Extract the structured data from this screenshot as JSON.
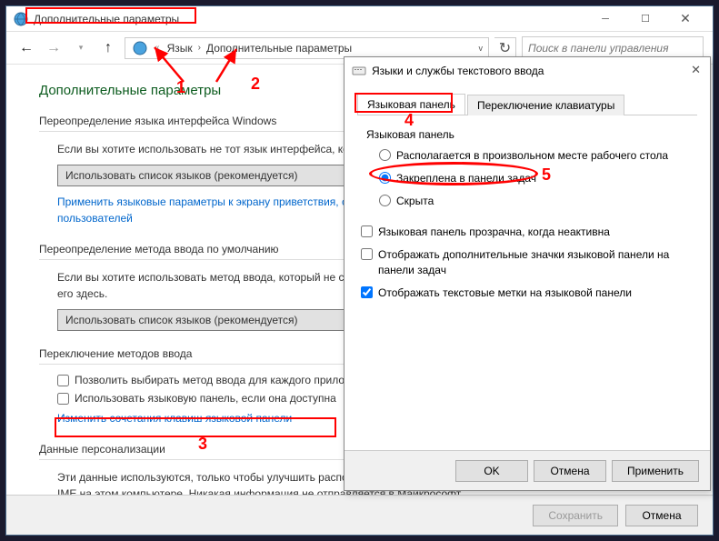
{
  "window": {
    "title": "Дополнительные параметры",
    "breadcrumb": {
      "prefix": "«",
      "item1": "Язык",
      "item2": "Дополнительные параметры"
    },
    "search_placeholder": "Поиск в панели управления"
  },
  "main": {
    "heading": "Дополнительные параметры",
    "section1": {
      "title": "Переопределение языка интерфейса Windows",
      "text": "Если вы хотите использовать не тот язык интерфейса, который соответствует вашему списку языков, выберите его здесь.",
      "combo": "Использовать список языков (рекомендуется)",
      "link": "Применить языковые параметры к экрану приветствия, системным учетным записям и новым учетным записям пользователей"
    },
    "section2": {
      "title": "Переопределение метода ввода по умолчанию",
      "text": "Если вы хотите использовать метод ввода, который не соответствует первому методу в вашем списке языков, выберите его здесь.",
      "combo": "Использовать список языков (рекомендуется)"
    },
    "section3": {
      "title": "Переключение методов ввода",
      "chk1": "Позволить выбирать метод ввода для каждого приложения",
      "chk2": "Использовать языковую панель, если она доступна",
      "link": "Изменить сочетания клавиш языковой панели"
    },
    "section4": {
      "title": "Данные персонализации",
      "text": "Эти данные используются, только чтобы улучшить распознавание рукописного ввода и текстовый ввод для языков без IME на этом компьютере. Никакая информация не отправляется в Майкрософт."
    },
    "buttons": {
      "save": "Сохранить",
      "cancel": "Отмена"
    }
  },
  "dialog": {
    "title": "Языки и службы текстового ввода",
    "tabs": {
      "tab1": "Языковая панель",
      "tab2": "Переключение клавиатуры"
    },
    "group1": {
      "title": "Языковая панель",
      "opt1": "Располагается в произвольном месте рабочего стола",
      "opt2": "Закреплена в панели задач",
      "opt3": "Скрыта"
    },
    "chk1": "Языковая панель прозрачна, когда неактивна",
    "chk2": "Отображать дополнительные значки языковой панели на панели задач",
    "chk3": "Отображать текстовые метки на языковой панели",
    "buttons": {
      "ok": "OK",
      "cancel": "Отмена",
      "apply": "Применить"
    }
  },
  "annotations": {
    "n1": "1",
    "n2": "2",
    "n3": "3",
    "n4": "4",
    "n5": "5"
  }
}
